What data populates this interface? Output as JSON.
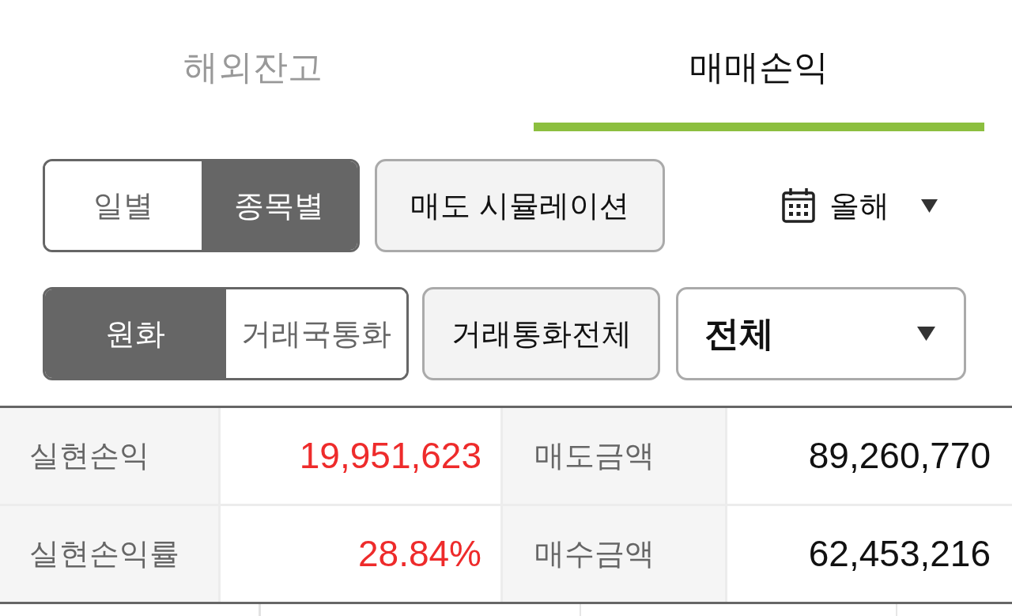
{
  "tabs": [
    {
      "label": "해외잔고",
      "selected": false
    },
    {
      "label": "매매손익",
      "selected": true
    }
  ],
  "view_toggle": [
    {
      "label": "일별",
      "selected": false
    },
    {
      "label": "종목별",
      "selected": true
    }
  ],
  "simulation_button": "매도 시뮬레이션",
  "period_picker": {
    "value": "올해"
  },
  "currency_toggle": [
    {
      "label": "원화",
      "selected": true
    },
    {
      "label": "거래국통화",
      "selected": false
    }
  ],
  "currency_button": "거래통화전체",
  "filter_dropdown": {
    "value": "전체"
  },
  "summary": {
    "rows": [
      [
        {
          "label": "실현손익",
          "value": "19,951,623",
          "color": "#ee2b2b"
        },
        {
          "label": "매도금액",
          "value": "89,260,770",
          "color": "#111111"
        }
      ],
      [
        {
          "label": "실현손익률",
          "value": "28.84%",
          "color": "#ee2b2b"
        },
        {
          "label": "매수금액",
          "value": "62,453,216",
          "color": "#111111"
        }
      ]
    ]
  }
}
